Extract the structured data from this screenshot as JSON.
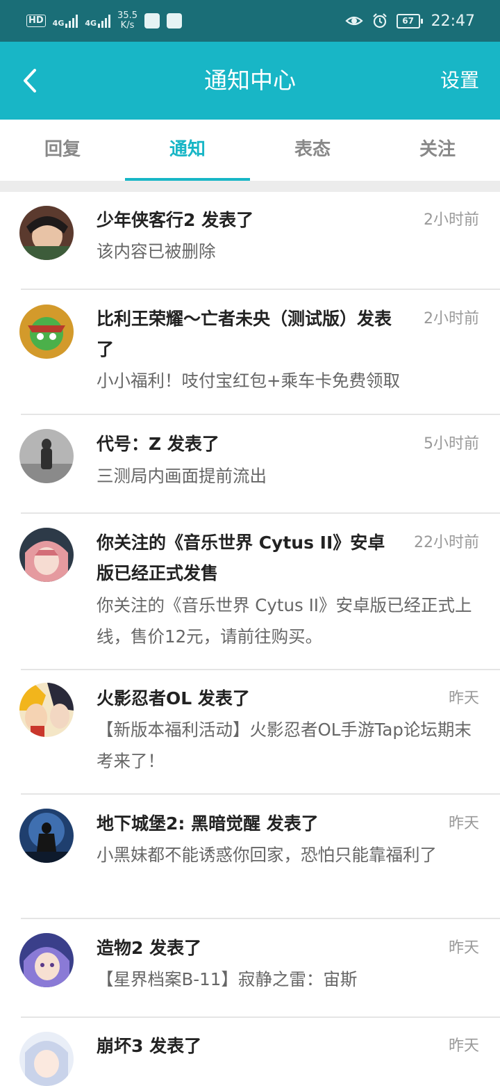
{
  "status_bar": {
    "hd_label": "HD",
    "sig1_label": "4G",
    "sig2_label": "4G",
    "speed_value": "35.5",
    "speed_unit": "K/s",
    "battery": "67",
    "time": "22:47"
  },
  "header": {
    "title": "通知中心",
    "settings_label": "设置"
  },
  "tabs": [
    {
      "label": "回复",
      "active": false
    },
    {
      "label": "通知",
      "active": true
    },
    {
      "label": "表态",
      "active": false
    },
    {
      "label": "关注",
      "active": false
    }
  ],
  "notifications": [
    {
      "title": "少年侠客行2 发表了",
      "time": "2小时前",
      "body": "该内容已被删除"
    },
    {
      "title": "比利王荣耀～亡者未央（测试版）发表了",
      "time": "2小时前",
      "body": "小小福利！吱付宝红包+乘车卡免费领取"
    },
    {
      "title": "代号：Z 发表了",
      "time": "5小时前",
      "body": "三测局内画面提前流出"
    },
    {
      "title": "你关注的《音乐世界 Cytus II》安卓版已经正式发售",
      "time": "22小时前",
      "body": "你关注的《音乐世界 Cytus II》安卓版已经正式上线，售价12元，请前往购买。"
    },
    {
      "title": "火影忍者OL 发表了",
      "time": "昨天",
      "body": "【新版本福利活动】火影忍者OL手游Tap论坛期末考来了！"
    },
    {
      "title": "地下城堡2: 黑暗觉醒 发表了",
      "time": "昨天",
      "body": "小黑妹都不能诱惑你回家，恐怕只能靠福利了"
    },
    {
      "title": "造物2 发表了",
      "time": "昨天",
      "body": "【星界档案B-11】寂静之雷：宙斯"
    },
    {
      "title": "崩坏3 发表了",
      "time": "昨天",
      "body": ""
    }
  ],
  "colors": {
    "status_bar": "#1a6e77",
    "accent": "#18b6c6",
    "title_text": "#222222",
    "body_text": "#666666",
    "time_text": "#999999"
  }
}
